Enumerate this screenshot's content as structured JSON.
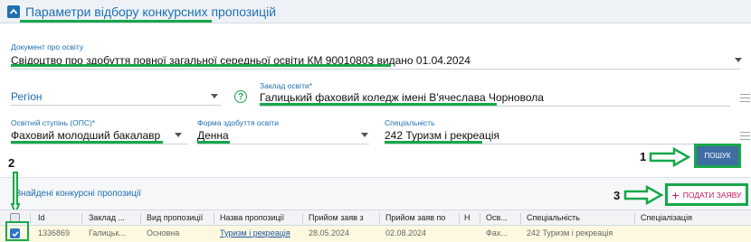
{
  "colors": {
    "accent": "#1f6fb2",
    "highlight": "#17a84a",
    "submit": "#c2185b",
    "search_bg": "#3f6ea3",
    "row_selected": "#fdf9e0"
  },
  "panel": {
    "title": "Параметри відбору конкурсних пропозицій",
    "toggle_icon": "chevron-up-icon"
  },
  "filters": {
    "document": {
      "label": "Документ про освіту",
      "value": "Свідоцтво про здобуття повної загальної середньої освіти КМ 90010803 видано 01.04.2024"
    },
    "region": {
      "label": "",
      "placeholder": "Регіон"
    },
    "institution": {
      "label": "Заклад освіти*",
      "value": "Галицький фаховий коледж імені В'ячеслава Чорновола"
    },
    "degree": {
      "label": "Освітній ступінь (ОПС)*",
      "value": "Фаховий молодший бакалавр"
    },
    "study_form": {
      "label": "Форма здобуття освіти",
      "value": "Денна"
    },
    "specialty": {
      "label": "Спеціальність",
      "value": "242 Туризм і рекреація"
    }
  },
  "search_button": {
    "label": "ПОШУК"
  },
  "annotations": {
    "n1": "1",
    "n2": "2",
    "n3": "3"
  },
  "results": {
    "title": "Знайдені конкурсні пропозиції",
    "submit_button": {
      "label": "ПОДАТИ ЗАЯВУ",
      "icon": "plus-icon"
    },
    "columns": [
      "Id",
      "Заклад ...",
      "Вид пропозиції",
      "Назва пропозиції",
      "Прийом заяв з",
      "Прийом заяв по",
      "Н",
      "Осв...",
      "Спеціальність",
      "Спеціалізація"
    ],
    "rows": [
      {
        "selected": true,
        "cells": [
          "1336869",
          "Галицьк...",
          "Основна",
          "Туризм і рекреація",
          "28.05.2024",
          "02.08.2024",
          "",
          "Фах...",
          "242 Туризм і рекреація",
          ""
        ]
      }
    ]
  }
}
